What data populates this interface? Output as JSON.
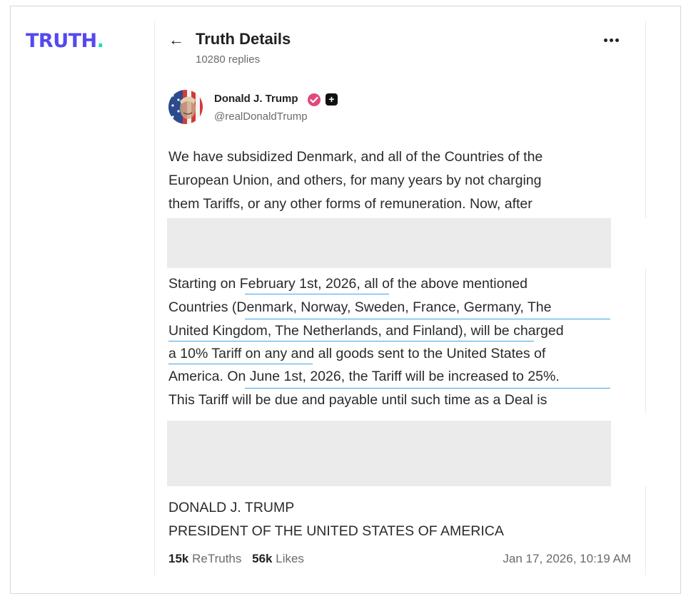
{
  "logo": {
    "text": "TRUTH",
    "dot": "."
  },
  "header": {
    "back_icon": "arrow-left-icon",
    "title": "Truth Details",
    "replies": "10280 replies",
    "more_icon": "more-horizontal-icon"
  },
  "post": {
    "author": "Donald J. Trump",
    "handle": "@realDonaldTrump",
    "verified_icon": "verified-badge-icon",
    "plus_icon": "plus-badge-icon",
    "plus_glyph": "+",
    "paragraph1": [
      "We have subsidized Denmark, and all of the Countries of the",
      "European Union, and others, for many years by not charging",
      "them Tariffs, or any other forms of remuneration. Now, after"
    ],
    "paragraph2": [
      "Starting on February 1st, 2026, all of the above mentioned",
      "Countries (Denmark, Norway, Sweden, France, Germany, The",
      "United Kingdom, The Netherlands, and Finland), will be charged",
      "a 10% Tariff on any and all goods sent to the United States of",
      "America. On June 1st, 2026, the Tariff will be increased to 25%.",
      "This Tariff will be due and payable until such time as a Deal is"
    ],
    "signature": [
      "DONALD J. TRUMP",
      "PRESIDENT OF THE UNITED STATES OF AMERICA"
    ],
    "retruths_count": "15k",
    "retruths_label": "ReTruths",
    "likes_count": "56k",
    "likes_label": "Likes",
    "timestamp": "Jan 17, 2026, 10:19 AM"
  },
  "colors": {
    "brand": "#5448ee",
    "brand_dot": "#17e2b3",
    "link_underline": "#3da6e6",
    "redaction": "#ebebeb"
  }
}
